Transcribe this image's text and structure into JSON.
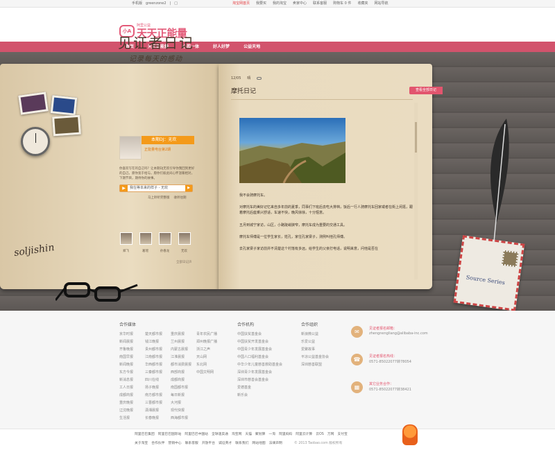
{
  "topbar": {
    "left": [
      "手机版",
      "greenzone2",
      "|",
      "□"
    ],
    "right": [
      "淘宝网首页",
      "我要买",
      "我的淘宝",
      "卖家中心",
      "联系客服",
      "购物车 0 件",
      "收藏夹",
      "网站导航"
    ]
  },
  "brand": {
    "small": "阿里公益",
    "name": "天天正能量",
    "icon_text": "小A"
  },
  "nav": [
    "首页",
    "天天正能量",
    "心若一体",
    "好人好梦",
    "公益天地"
  ],
  "left_page": {
    "title": "见证者日记",
    "subtitle": "记录每天的感动",
    "dj_label": "本期DJ：无欢",
    "dj_sub": "正能量电台第2期",
    "intro": "你喜欢写在的自己吗？让本期DJ无欢引导你我回到更好的自己。愿你宽于给与，愿你们彼此间心怀温暖相对，下期节目，期待你的故事。",
    "player_text": "我在等本来的样子 - 无欢",
    "player_links": [
      "马上聆听完整版",
      "收听往期"
    ],
    "signature": "soljishin",
    "avatars": [
      "郑飞",
      "葛瑶",
      "孙春龙",
      "无欢"
    ],
    "more": "全部日记声"
  },
  "right_page": {
    "date": "12/05",
    "weather": "晴",
    "title": "摩托日记",
    "tag": "查看全部日记",
    "paragraphs": [
      "我不会骑摩托车。",
      "对摩托车的美好记忆来自多年前的夏季，同事们下班后去吃大排档，饭后一行人骑摩托车回家或者在街上闲逛，跟着摩托后座乘兴舒适，车速不快，晚风徐徐，十分惬意。",
      "五月到城宁家访，山区，小路陡峭狭窄，摩托车成为重要的交通工具。",
      "摩托车师傅是一位学生家长，姓孔，家住孔家梁子，测例叫他孔师傅。",
      "去孔家梁子家访前并不清楚这个村落有多远。给学生的父亲打电话，说明来意，问他是否在"
    ]
  },
  "envelope": {
    "text": "Source Series"
  },
  "footer": {
    "media_title": "合作媒体",
    "media": [
      [
        "京华时报",
        "楚天都市报",
        "重庆晨报",
        "青年农民广播"
      ],
      [
        "新闻晨报",
        "钱江晚报",
        "兰州晨报",
        "郑州晚报广播"
      ],
      [
        "齐鲁晚报",
        "贵州都市报",
        "内蒙古晨报",
        "浙江之声"
      ],
      [
        "南国早报",
        "江南都市报",
        "江淮晨报",
        "天山网"
      ],
      [
        "新闻晚报",
        "华西都市报",
        "都市消费晨报",
        "东北网"
      ],
      [
        "东方今报",
        "三秦都市报",
        "西部商报",
        "中国文明网"
      ],
      [
        "新消息报",
        "四川在线",
        "成都商报",
        ""
      ],
      [
        "工人日报",
        "扬子晚报",
        "南国都市报",
        ""
      ],
      [
        "成都商报",
        "南方都市报",
        "每日新报",
        ""
      ],
      [
        "重庆晚报",
        "三晋都市报",
        "大河报",
        ""
      ],
      [
        "辽沈晚报",
        "潇湘晨报",
        "现代快报",
        ""
      ],
      [
        "生活报",
        "长春晚报",
        "西海都市报",
        ""
      ]
    ],
    "org_title": "合作机构",
    "orgs": [
      "中国扶贫基金会",
      "中国扶贫开发基金会",
      "中国青少年发展基金会",
      "中国人口福利基金会",
      "中华少年儿童慈善救助基金会",
      "深圳青少年发展基金会",
      "深圳市慈善会基金会",
      "爱德基金",
      "新乐会"
    ],
    "group_title": "合作组织",
    "groups": [
      "新浪微公益",
      "乐爱公益",
      "爱聚故事",
      "平凉公益基金协会",
      "深圳慈善联盟"
    ],
    "contacts": [
      {
        "icon": "mail-icon",
        "title": "见证者报名邮箱：",
        "value": "zhengnengliang@alibaba-inc.com"
      },
      {
        "icon": "phone-icon",
        "title": "见证者报名热线：",
        "value": "0571-85022077转78054"
      },
      {
        "icon": "building-icon",
        "title": "其它业务合作：",
        "value": "0571-85022077转38421"
      }
    ]
  },
  "bottom": {
    "row1": [
      "阿里巴巴集团",
      "阿里巴巴国际站",
      "阿里巴巴中国站",
      "全球速卖通",
      "淘宝网",
      "天猫",
      "聚划算",
      "一淘",
      "阿里妈妈",
      "阿里云计算",
      "云OS",
      "万网",
      "支付宝"
    ],
    "row2": [
      "关于淘宝",
      "合作伙伴",
      "营销中心",
      "联系客服",
      "开放平台",
      "诚征英才",
      "联系我们",
      "网站地图",
      "法律声明"
    ],
    "copyright": "© 2013 Taobao.com 版权所有"
  },
  "colors": {
    "accent": "#d2536c",
    "orange": "#f49a1a"
  }
}
